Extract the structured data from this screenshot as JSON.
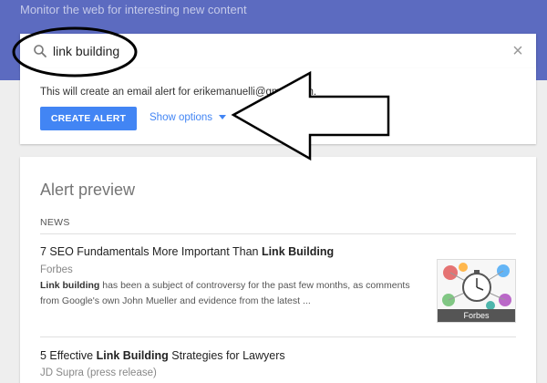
{
  "header": {
    "tagline": "Monitor the web for interesting new content"
  },
  "search": {
    "value": "link building",
    "icon": "search-icon",
    "clear_icon": "close-icon"
  },
  "alert_card": {
    "email_note": "This will create an email alert for erikemanuelli@gmail.com.",
    "create_label": "CREATE ALERT",
    "options_label": "Show options"
  },
  "preview": {
    "title": "Alert preview",
    "section": "NEWS",
    "items": [
      {
        "title_pre": "7 SEO Fundamentals More Important Than ",
        "title_bold": "Link Building",
        "title_post": "",
        "source": "Forbes",
        "snippet_bold": "Link building",
        "snippet_rest": " has been a subject of controversy for the past few months, as comments",
        "snippet_line2": "from Google's own John Mueller and evidence from the latest ...",
        "thumb_caption": "Forbes"
      },
      {
        "title_pre": "5 Effective ",
        "title_bold": "Link Building",
        "title_post": " Strategies for Lawyers",
        "source": "JD Supra (press release)"
      }
    ]
  },
  "colors": {
    "header_band": "#5c6bc0",
    "primary_button": "#4285f4",
    "link": "#4285f4"
  }
}
